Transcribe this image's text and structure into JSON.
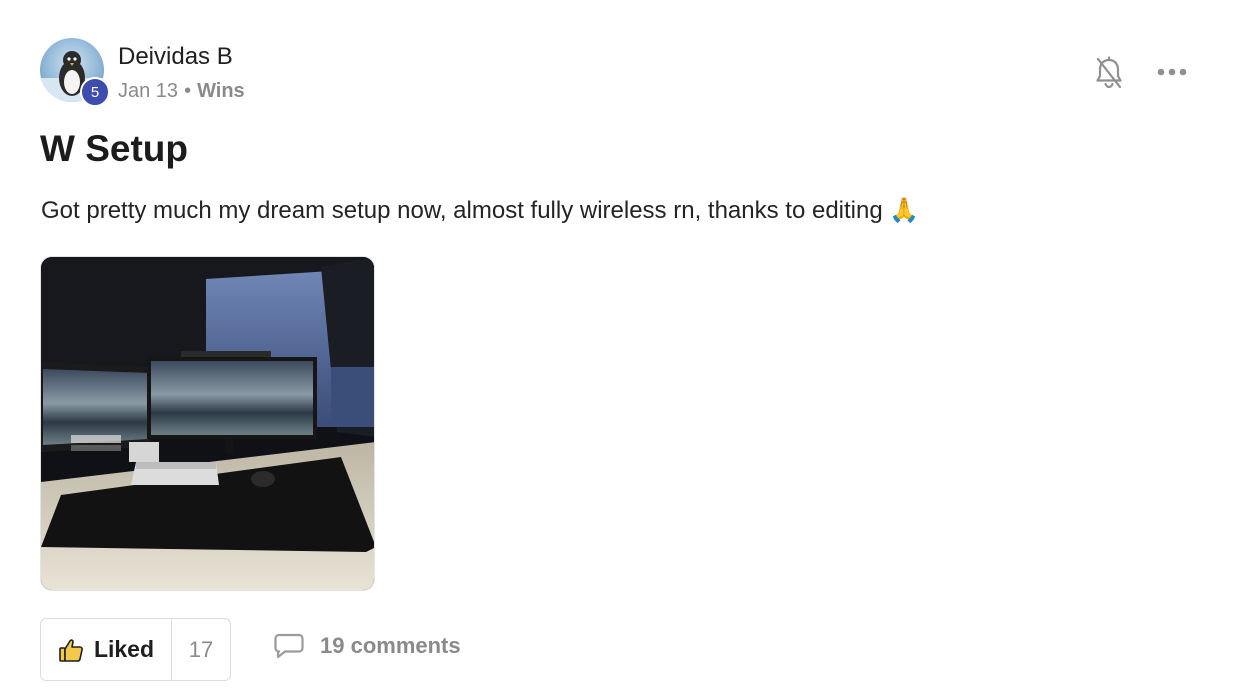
{
  "post": {
    "author": "Deividas B",
    "level": "5",
    "date": "Jan 13",
    "separator": "•",
    "category": "Wins",
    "title": "W Setup",
    "body": "Got pretty much my dream setup now, almost fully wireless rn, thanks to editing",
    "emoji": "🙏"
  },
  "actions": {
    "like_label": "Liked",
    "like_count": "17",
    "comments_label": "19 comments"
  },
  "icons": {
    "avatar": "penguin-avatar",
    "bell": "bell-off-icon",
    "more": "more-horizontal-icon",
    "like": "thumbs-up-icon",
    "comment": "comment-icon"
  },
  "colors": {
    "level_badge": "#3d4cae",
    "like_icon": "#f2c94c",
    "muted_text": "#8a8a8a"
  }
}
